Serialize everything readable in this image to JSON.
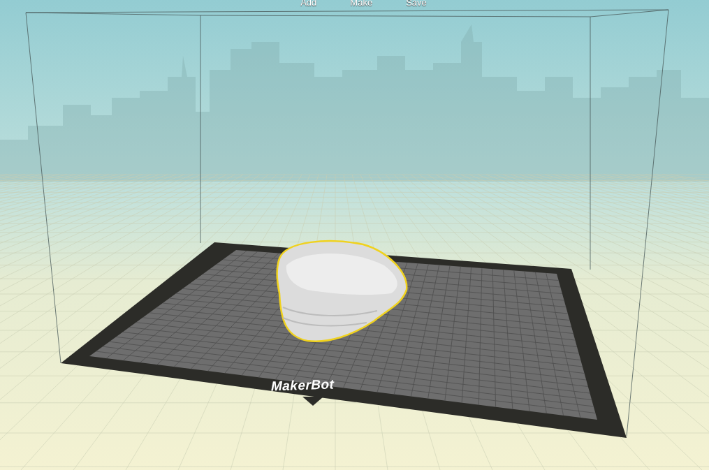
{
  "toolbar": [
    {
      "label": "Add"
    },
    {
      "label": "Make"
    },
    {
      "label": "Save"
    }
  ],
  "plate": {
    "brand": "MakerBot"
  },
  "model": {
    "selected": true
  }
}
